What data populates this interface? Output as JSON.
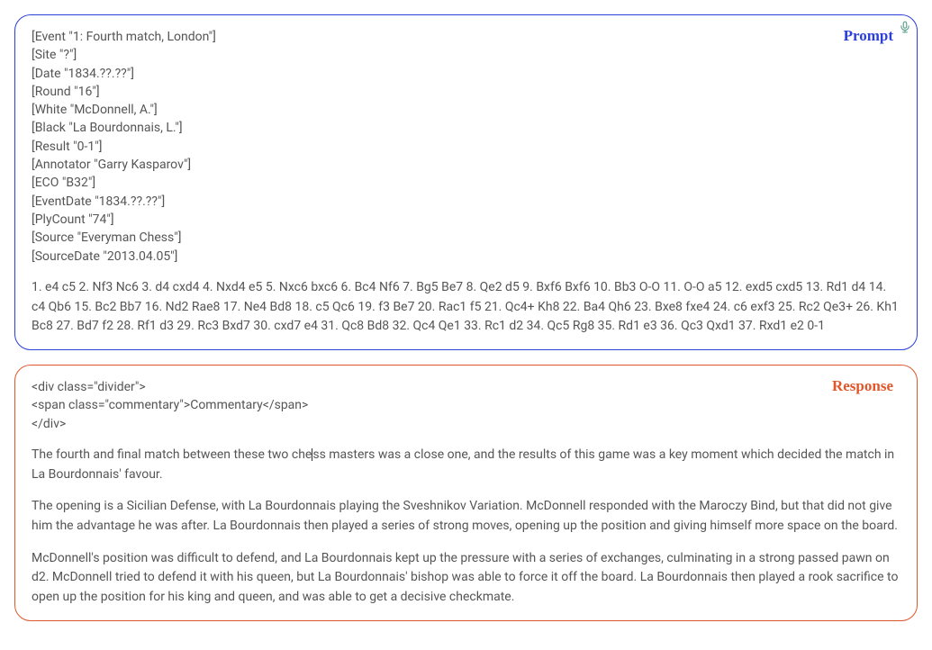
{
  "prompt": {
    "label": "Prompt",
    "pgnHeaders": [
      "[Event \"1: Fourth match, London\"]",
      "[Site \"?\"]",
      "[Date \"1834.??.??\"]",
      "[Round \"16\"]",
      "[White \"McDonnell, A.\"]",
      "[Black \"La Bourdonnais, L.\"]",
      "[Result \"0-1\"]",
      "[Annotator \"Garry Kasparov\"]",
      "[ECO \"B32\"]",
      "[EventDate \"1834.??.??\"]",
      "[PlyCount \"74\"]",
      "[Source \"Everyman Chess\"]",
      "[SourceDate \"2013.04.05\"]"
    ],
    "moves": "1. e4 c5 2. Nf3 Nc6 3. d4 cxd4 4. Nxd4 e5 5. Nxc6 bxc6 6. Bc4 Nf6 7. Bg5 Be7 8. Qe2 d5 9. Bxf6 Bxf6 10. Bb3 O-O 11. O-O a5 12. exd5 cxd5 13. Rd1 d4 14. c4 Qb6 15. Bc2 Bb7 16. Nd2 Rae8 17. Ne4 Bd8 18. c5 Qc6 19. f3 Be7 20. Rac1 f5 21. Qc4+ Kh8 22. Ba4 Qh6 23. Bxe8 fxe4 24. c6 exf3 25. Rc2 Qe3+ 26. Kh1 Bc8 27. Bd7 f2 28. Rf1 d3 29. Rc3 Bxd7 30. cxd7 e4 31. Qc8 Bd8 32. Qc4 Qe1 33. Rc1 d2 34. Qc5 Rg8 35. Rd1 e3 36. Qc3 Qxd1 37. Rxd1 e2 0-1"
  },
  "response": {
    "label": "Response",
    "codeLines": [
      "<div class=\"divider\">",
      "<span class=\"commentary\">Commentary</span>",
      "</div>"
    ],
    "paragraphs": {
      "p1a": "The fourth and final match between these two che",
      "p1b": "ss masters was a close one, and the results of this game was a key moment which decided the match in La Bourdonnais' favour.",
      "p2": "The opening is a Sicilian Defense, with La Bourdonnais playing the Sveshnikov Variation. McDonnell responded with the Maroczy Bind, but that did not give him the advantage he was after. La Bourdonnais then played a series of strong moves, opening up the position and giving himself more space on the board.",
      "p3": "McDonnell's position was difficult to defend, and La Bourdonnais kept up the pressure with a series of exchanges, culminating in a strong passed pawn on d2. McDonnell tried to defend it with his queen, but La Bourdonnais' bishop was able to force it off the board. La Bourdonnais then played a rook sacrifice to open up the position for his king and queen, and was able to get a decisive checkmate."
    }
  },
  "icons": {
    "mic": "microphone-icon"
  }
}
